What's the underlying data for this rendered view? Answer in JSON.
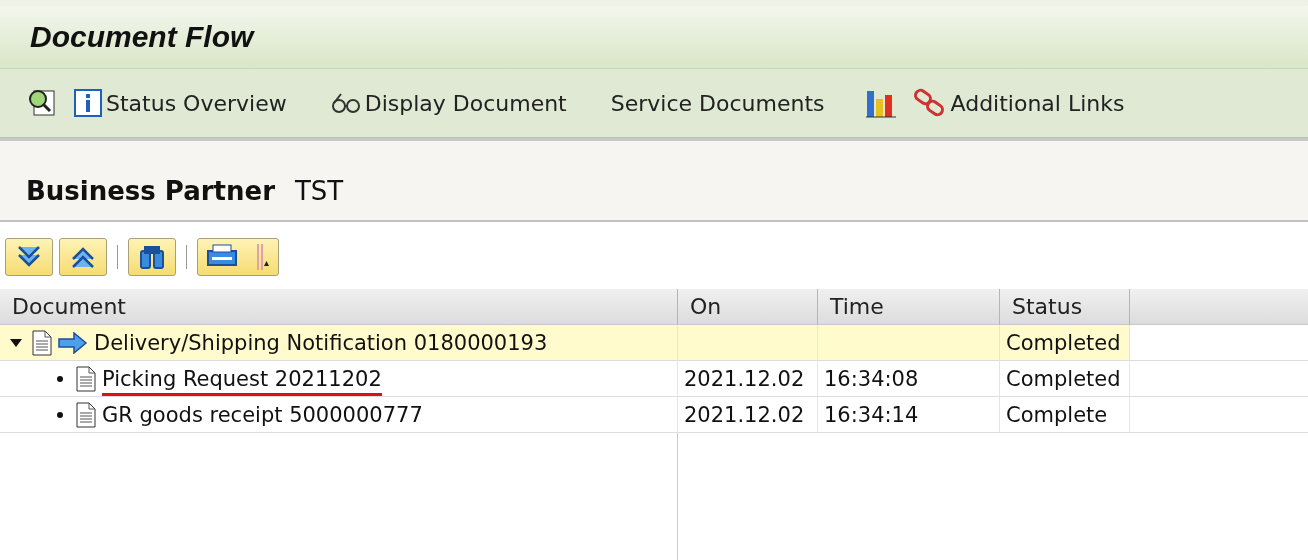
{
  "window": {
    "title": "Document Flow"
  },
  "toolbar": [
    {
      "kind": "icon"
    },
    {
      "kind": "button",
      "label": "Status Overview"
    },
    {
      "kind": "button",
      "label": "Display Document"
    },
    {
      "kind": "button",
      "label": "Service Documents"
    },
    {
      "kind": "icon"
    },
    {
      "kind": "button",
      "label": "Additional Links"
    }
  ],
  "header": {
    "label": "Business Partner",
    "value": "TST"
  },
  "table": {
    "columns": [
      "Document",
      "On",
      "Time",
      "Status"
    ],
    "rows": [
      {
        "document": "Delivery/Shipping Notification 0180000193",
        "status": "Completed",
        "selected": true,
        "expanded": true,
        "underlined": false,
        "children": [
          {
            "document": "Picking Request 20211202",
            "on": "2021.12.02",
            "time": "16:34:08",
            "status": "Completed",
            "selected": false,
            "underlined": true
          },
          {
            "document": "GR goods receipt 5000000777",
            "on": "2021.12.02",
            "time": "16:34:14",
            "status": "Complete",
            "selected": false,
            "underlined": false
          }
        ]
      }
    ]
  }
}
